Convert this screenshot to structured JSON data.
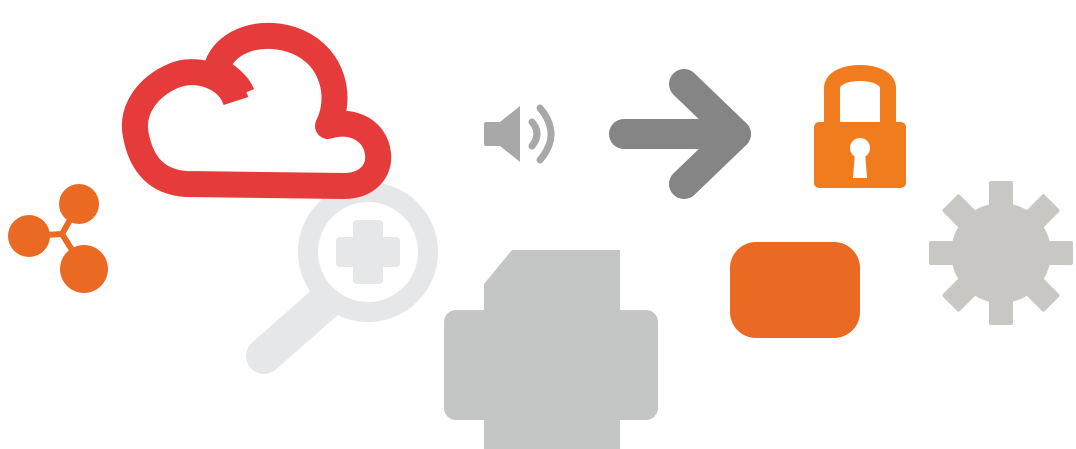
{
  "colors": {
    "orange": "#EB6A23",
    "lock_orange": "#F07C1E",
    "red": "#E63B3B",
    "dark_gray": "#858585",
    "mid_gray": "#A8A8A8",
    "light_gray": "#C4C5C5",
    "pale_gray": "#E6E7E8",
    "gear_gray": "#C9C7C3",
    "white": "#FFFFFF"
  },
  "icons": [
    {
      "name": "share-icon",
      "color": "orange"
    },
    {
      "name": "zoom-in-icon",
      "color": "pale_gray"
    },
    {
      "name": "cloud-icon",
      "color": "red"
    },
    {
      "name": "speaker-icon",
      "color": "mid_gray"
    },
    {
      "name": "arrow-right-icon",
      "color": "dark_gray"
    },
    {
      "name": "lock-icon",
      "color": "lock_orange"
    },
    {
      "name": "printer-icon",
      "color": "light_gray"
    },
    {
      "name": "rounded-rectangle-icon",
      "color": "orange"
    },
    {
      "name": "gear-icon",
      "color": "gear_gray"
    }
  ]
}
